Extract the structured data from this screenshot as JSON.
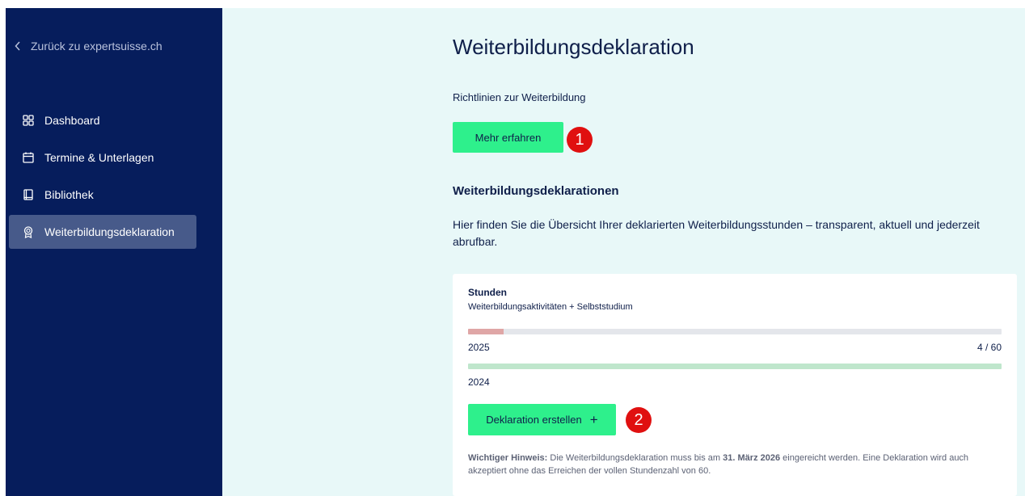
{
  "sidebar": {
    "back_label": "Zurück zu expertsuisse.ch",
    "items": [
      {
        "label": "Dashboard",
        "icon": "dashboard-grid-icon",
        "active": false
      },
      {
        "label": "Termine & Unterlagen",
        "icon": "calendar-icon",
        "active": false
      },
      {
        "label": "Bibliothek",
        "icon": "book-icon",
        "active": false
      },
      {
        "label": "Weiterbildungsdeklaration",
        "icon": "award-icon",
        "active": true
      }
    ]
  },
  "main": {
    "title": "Weiterbildungsdeklaration",
    "guidelines_label": "Richtlinien zur Weiterbildung",
    "more_button": "Mehr erfahren",
    "marker_1": "1",
    "section_heading": "Weiterbildungsdeklarationen",
    "section_desc": "Hier finden Sie die Übersicht Ihrer deklarierten Weiterbildungsstunden – transparent, aktuell und jederzeit abrufbar."
  },
  "card": {
    "title": "Stunden",
    "subtitle": "Weiterbildungsaktivitäten + Selbststudium",
    "years": [
      {
        "year": "2025",
        "ratio": "4 / 60",
        "progress": 0.067,
        "color": "#dfa6a6"
      },
      {
        "year": "2024",
        "ratio": "",
        "progress": 1.0,
        "color": "#bfe6cc"
      }
    ],
    "declare_button": "Deklaration erstellen",
    "declare_icon": "plus-icon",
    "marker_2": "2",
    "notice_bold": "Wichtiger Hinweis:",
    "notice_part1": " Die Weiterbildungsdeklaration muss bis am ",
    "notice_date": "31. März 2026",
    "notice_part2": " eingereicht werden. Eine Deklaration wird auch akzeptiert ohne das Erreichen der vollen Stundenzahl von 60."
  },
  "colors": {
    "sidebar_bg": "#061d5c",
    "main_bg": "#e8f8f8",
    "accent_green": "#2ef08c",
    "marker_red": "#e01010"
  }
}
